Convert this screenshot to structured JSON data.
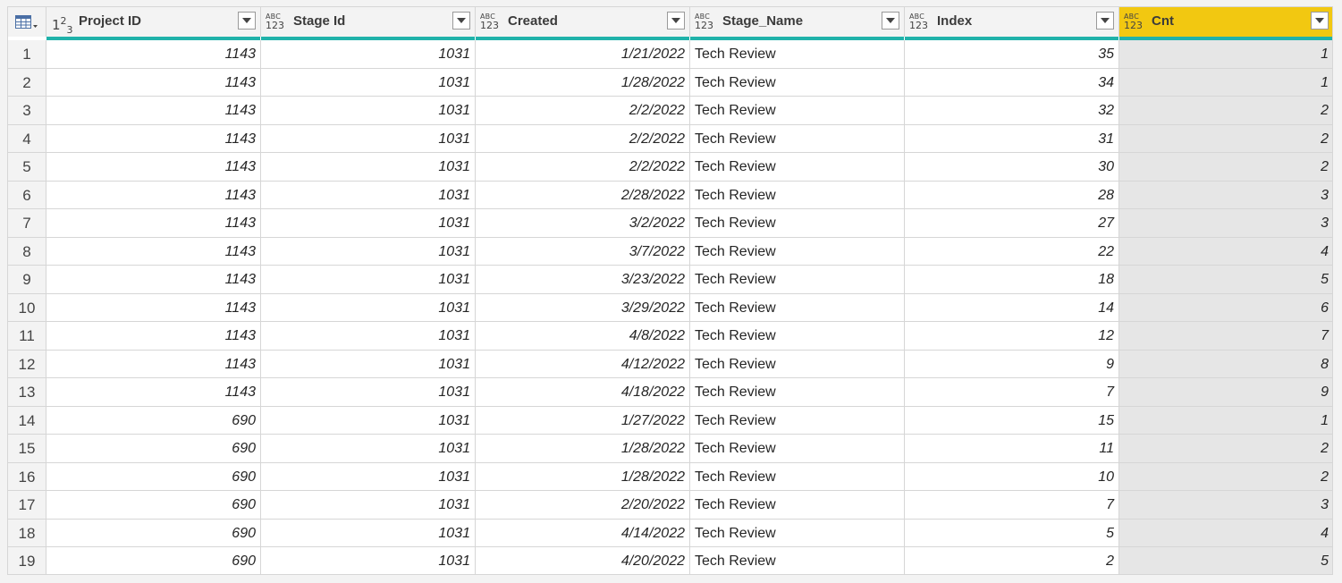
{
  "table": {
    "columns": [
      {
        "name": "Project ID",
        "type": "123",
        "align": "num"
      },
      {
        "name": "Stage Id",
        "type": "ABC123",
        "align": "num"
      },
      {
        "name": "Created",
        "type": "ABC123",
        "align": "num"
      },
      {
        "name": "Stage_Name",
        "type": "ABC123",
        "align": "txt"
      },
      {
        "name": "Index",
        "type": "ABC123",
        "align": "num"
      },
      {
        "name": "Cnt",
        "type": "ABC123",
        "align": "num",
        "selected": true
      }
    ],
    "type_labels": {
      "abc": "ABC",
      "num123": "123"
    },
    "rows": [
      {
        "n": "1",
        "cells": [
          "1143",
          "1031",
          "1/21/2022",
          "Tech Review",
          "35",
          "1"
        ]
      },
      {
        "n": "2",
        "cells": [
          "1143",
          "1031",
          "1/28/2022",
          "Tech Review",
          "34",
          "1"
        ]
      },
      {
        "n": "3",
        "cells": [
          "1143",
          "1031",
          "2/2/2022",
          "Tech Review",
          "32",
          "2"
        ]
      },
      {
        "n": "4",
        "cells": [
          "1143",
          "1031",
          "2/2/2022",
          "Tech Review",
          "31",
          "2"
        ]
      },
      {
        "n": "5",
        "cells": [
          "1143",
          "1031",
          "2/2/2022",
          "Tech Review",
          "30",
          "2"
        ]
      },
      {
        "n": "6",
        "cells": [
          "1143",
          "1031",
          "2/28/2022",
          "Tech Review",
          "28",
          "3"
        ]
      },
      {
        "n": "7",
        "cells": [
          "1143",
          "1031",
          "3/2/2022",
          "Tech Review",
          "27",
          "3"
        ]
      },
      {
        "n": "8",
        "cells": [
          "1143",
          "1031",
          "3/7/2022",
          "Tech Review",
          "22",
          "4"
        ]
      },
      {
        "n": "9",
        "cells": [
          "1143",
          "1031",
          "3/23/2022",
          "Tech Review",
          "18",
          "5"
        ]
      },
      {
        "n": "10",
        "cells": [
          "1143",
          "1031",
          "3/29/2022",
          "Tech Review",
          "14",
          "6"
        ]
      },
      {
        "n": "11",
        "cells": [
          "1143",
          "1031",
          "4/8/2022",
          "Tech Review",
          "12",
          "7"
        ]
      },
      {
        "n": "12",
        "cells": [
          "1143",
          "1031",
          "4/12/2022",
          "Tech Review",
          "9",
          "8"
        ]
      },
      {
        "n": "13",
        "cells": [
          "1143",
          "1031",
          "4/18/2022",
          "Tech Review",
          "7",
          "9"
        ]
      },
      {
        "n": "14",
        "cells": [
          "690",
          "1031",
          "1/27/2022",
          "Tech Review",
          "15",
          "1"
        ]
      },
      {
        "n": "15",
        "cells": [
          "690",
          "1031",
          "1/28/2022",
          "Tech Review",
          "11",
          "2"
        ]
      },
      {
        "n": "16",
        "cells": [
          "690",
          "1031",
          "1/28/2022",
          "Tech Review",
          "10",
          "2"
        ]
      },
      {
        "n": "17",
        "cells": [
          "690",
          "1031",
          "2/20/2022",
          "Tech Review",
          "7",
          "3"
        ]
      },
      {
        "n": "18",
        "cells": [
          "690",
          "1031",
          "4/14/2022",
          "Tech Review",
          "5",
          "4"
        ]
      },
      {
        "n": "19",
        "cells": [
          "690",
          "1031",
          "4/20/2022",
          "Tech Review",
          "2",
          "5"
        ]
      }
    ]
  },
  "colors": {
    "selected_header": "#f2c811",
    "quality_bar": "#20b2aa",
    "selected_column_bg": "#e6e6e6"
  }
}
